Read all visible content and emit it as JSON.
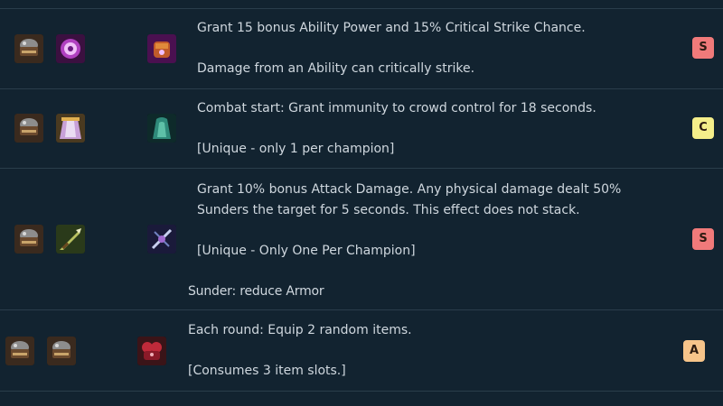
{
  "colors": {
    "background": "#122330",
    "divider": "#2a3d4b",
    "text": "#cfd7de",
    "tier_S": "#f07a7a",
    "tier_C": "#f4ee8a",
    "tier_A": "#f6c48a"
  },
  "rows": [
    {
      "components": [
        "sparring-gloves-icon",
        "jeweled-gauntlet-component-icon"
      ],
      "result": "jeweled-gauntlet-emblem-icon",
      "lines": [
        "Grant 15 bonus Ability Power and 15% Critical Strike Chance.",
        "",
        "Damage from an Ability can critically strike."
      ],
      "tier": "S"
    },
    {
      "components": [
        "sparring-gloves-icon",
        "negatron-cloak-icon"
      ],
      "result": "quicksilver-icon",
      "lines": [
        "Combat start: Grant immunity to crowd control for 18 seconds.",
        "",
        "[Unique - only 1 per champion]"
      ],
      "tier": "C"
    },
    {
      "components": [
        "sparring-gloves-icon",
        "bf-sword-icon"
      ],
      "result": "last-whisper-icon",
      "lines": [
        "Grant 10% bonus Attack Damage. Any physical damage dealt 50%",
        "Sunders the target for 5 seconds. This effect does not stack.",
        "",
        "[Unique - Only One Per Champion]"
      ],
      "note": "Sunder: reduce Armor",
      "tier": "S"
    },
    {
      "components": [
        "sparring-gloves-icon",
        "sparring-gloves-icon"
      ],
      "result": "thiefs-gloves-icon",
      "lines": [
        "Each round: Equip 2 random items.",
        "",
        "[Consumes 3 item slots.]"
      ],
      "tier": "A"
    }
  ]
}
